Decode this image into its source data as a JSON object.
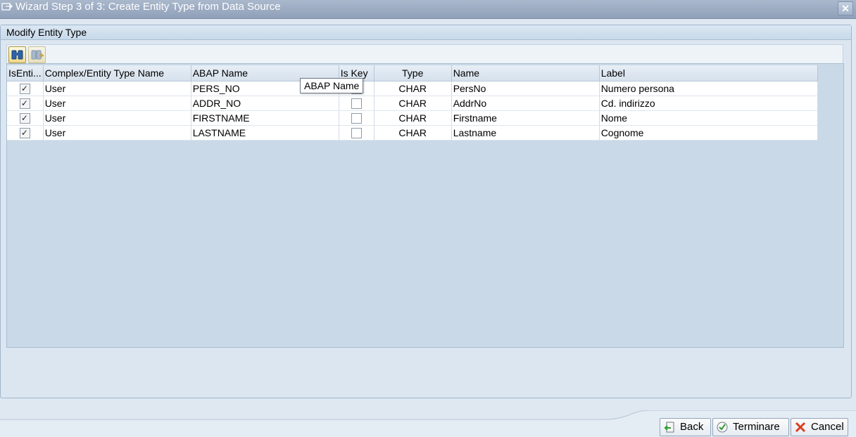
{
  "window": {
    "title": "Wizard Step 3 of 3: Create Entity Type from Data Source",
    "close_label": "x"
  },
  "group": {
    "title": "Modify Entity Type"
  },
  "toolbar": {
    "icons": [
      "binoculars-icon",
      "add-row-icon"
    ]
  },
  "table": {
    "columns": [
      "IsEnti...",
      "Complex/Entity Type Name",
      "ABAP Name",
      "Is Key",
      "Type",
      "Name",
      "Label"
    ],
    "rows": [
      {
        "is_entity": true,
        "type_name": "User",
        "abap_name": "PERS_NO",
        "is_key": false,
        "type": "CHAR",
        "name": "PersNo",
        "label": "Numero persona"
      },
      {
        "is_entity": true,
        "type_name": "User",
        "abap_name": "ADDR_NO",
        "is_key": false,
        "type": "CHAR",
        "name": "AddrNo",
        "label": "Cd. indirizzo"
      },
      {
        "is_entity": true,
        "type_name": "User",
        "abap_name": "FIRSTNAME",
        "is_key": false,
        "type": "CHAR",
        "name": "Firstname",
        "label": "Nome"
      },
      {
        "is_entity": true,
        "type_name": "User",
        "abap_name": "LASTNAME",
        "is_key": false,
        "type": "CHAR",
        "name": "Lastname",
        "label": "Cognome"
      }
    ]
  },
  "tooltip": {
    "text": "ABAP Name"
  },
  "buttons": {
    "back": "Back",
    "finish": "Terminare",
    "cancel": "Cancel"
  }
}
